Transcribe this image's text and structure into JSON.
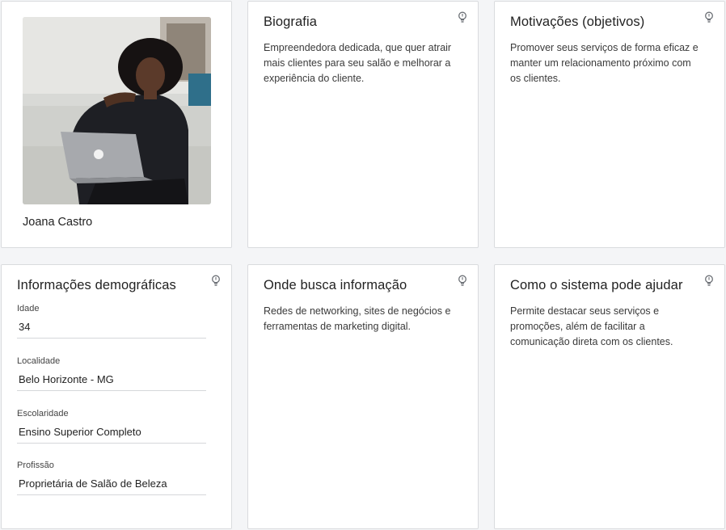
{
  "persona": {
    "name": "Joana Castro",
    "photo_alt": "Foto da persona"
  },
  "cards": {
    "biografia": {
      "title": "Biografia",
      "text": "Empreendedora dedicada, que quer atrair mais clientes para seu salão e melhorar a experiência do cliente."
    },
    "motivacoes": {
      "title": "Motivações (objetivos)",
      "text": "Promover seus serviços de forma eficaz e manter um relacionamento próximo com os clientes."
    },
    "demograficas": {
      "title": "Informações demográficas",
      "fields": [
        {
          "label": "Idade",
          "value": "34"
        },
        {
          "label": "Localidade",
          "value": "Belo Horizonte - MG"
        },
        {
          "label": "Escolaridade",
          "value": "Ensino Superior Completo"
        },
        {
          "label": "Profissão",
          "value": "Proprietária de Salão de Beleza"
        }
      ]
    },
    "busca_informacao": {
      "title": "Onde busca informação",
      "text": "Redes de networking, sites de negócios e ferramentas de marketing digital."
    },
    "sistema_ajuda": {
      "title": "Como o sistema pode ajudar",
      "text": "Permite destacar seus serviços e promoções, além de facilitar a comunicação direta com os clientes."
    }
  },
  "icons": {
    "tip": "lightbulb-icon"
  }
}
